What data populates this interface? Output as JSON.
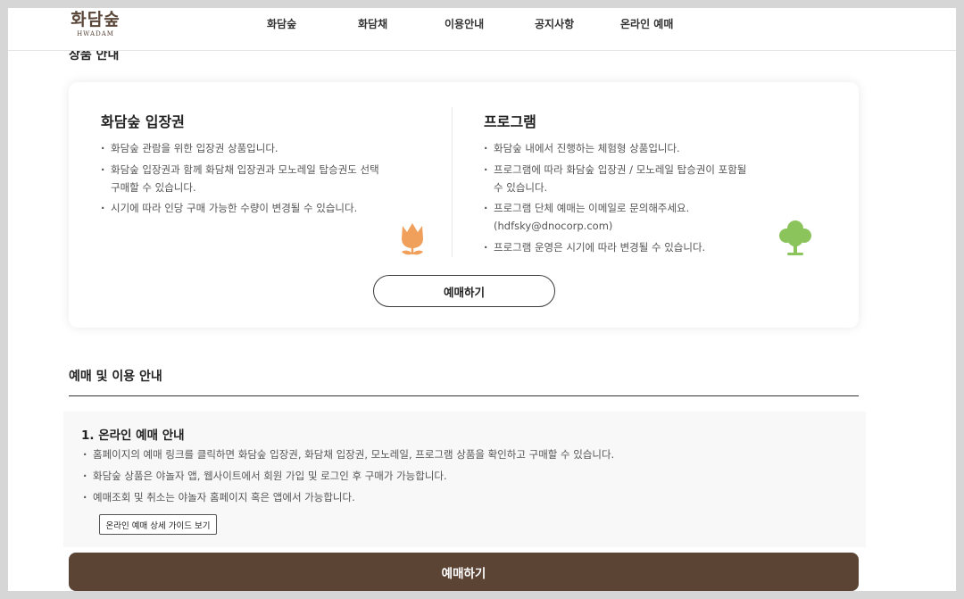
{
  "header": {
    "logo_text": "화담숲",
    "logo_sub": "HWADAM",
    "nav": [
      "화담숲",
      "화담채",
      "이용안내",
      "공지사항",
      "온라인 예매"
    ]
  },
  "product_section": {
    "title": "상품 안내",
    "left": {
      "title": "화담숲 입장권",
      "items": [
        "화담숲 관람을 위한 입장권 상품입니다.",
        "화담숲 입장권과 함께 화담채 입장권과 모노레일 탑승권도 선택",
        "구매할 수 있습니다.",
        "시기에 따라 인당 구매 가능한 수량이 변경될 수 있습니다."
      ],
      "icon": "tulip-icon"
    },
    "right": {
      "title": "프로그램",
      "items": [
        "화담숲 내에서 진행하는 체험형 상품입니다.",
        "프로그램에 따라 화담숲 입장권 / 모노레일 탑승권이 포함될",
        "수 있습니다.",
        "프로그램 단체 예매는 이메일로 문의해주세요.",
        "(hdfsky@dnocorp.com)",
        "프로그램 운영은 시기에 따라 변경될 수 있습니다."
      ],
      "icon": "tree-icon"
    },
    "button_label": "예매하기"
  },
  "booking_section": {
    "title": "예매 및 이용 안내",
    "box_title": "1. 온라인 예매 안내",
    "items": [
      "홈페이지의 예매 링크를 클릭하면 화담숲 입장권, 화담채 입장권, 모노레일, 프로그램 상품을 확인하고 구매할 수 있습니다.",
      "화담숲 상품은 야놀자 앱, 웹사이트에서 회원 가입 및 로그인 후 구매가 가능합니다.",
      "예매조회 및 취소는 야놀자 홈페이지 혹은 앱에서 가능합니다."
    ],
    "guide_button": "온라인 예매 상세 가이드 보기"
  },
  "sticky_button": "예매하기",
  "colors": {
    "brand_brown": "#5c4435",
    "tulip_orange": "#f0a05a",
    "tree_green": "#8cc45c"
  }
}
